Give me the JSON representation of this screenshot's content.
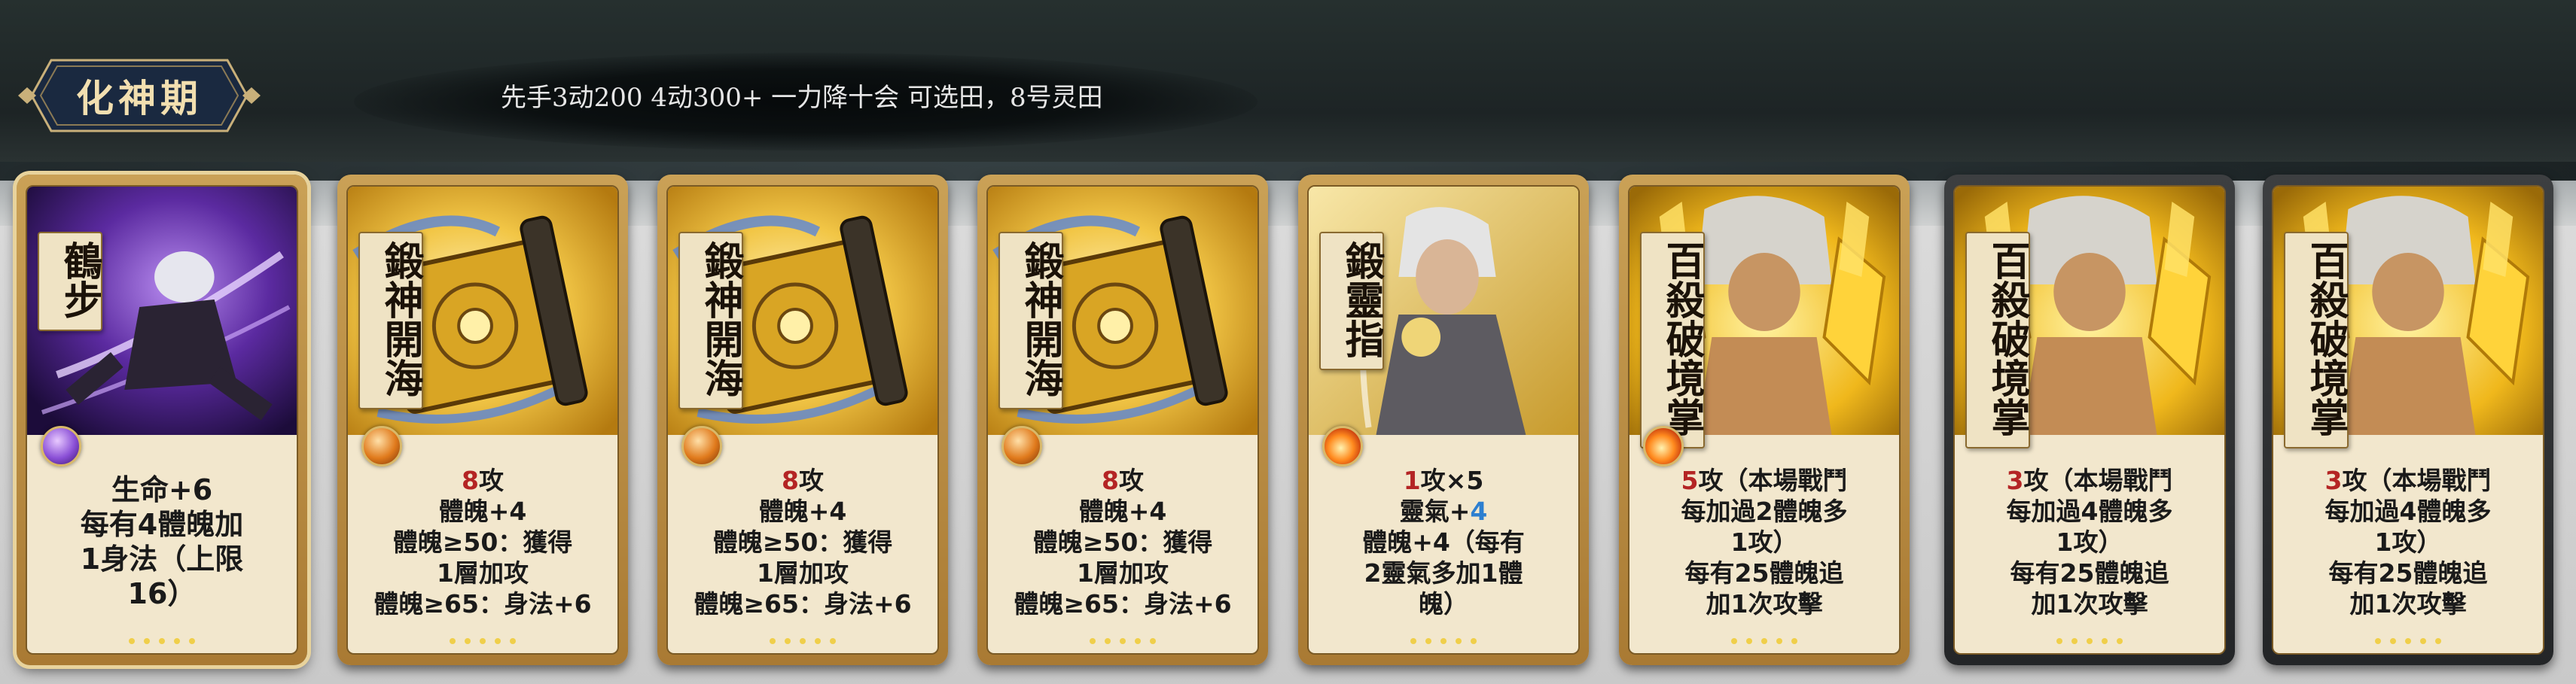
{
  "header": {
    "stage": "化神期",
    "note": "先手3动200  4动300+    一力降十会  可选田，8号灵田"
  },
  "colors": {
    "gold_frame": "#caa156",
    "dark_frame": "#2e3032",
    "attack_red": "#b42424",
    "qi_blue": "#2d7fd0",
    "orb_purple": "#8a4fd6",
    "orb_orange": "#e07a1c"
  },
  "cards": [
    {
      "name": "鶴步",
      "frame": "gold",
      "art": "purple-cultivator-art",
      "orb": "purple",
      "lines": [
        "生命+6",
        "每有4體魄加",
        "1身法（上限",
        "16）"
      ]
    },
    {
      "name": "鍛神開海",
      "frame": "gold",
      "art": "golden-scroll-art",
      "orb": "orange",
      "atk": "8",
      "atk_suffix": "攻",
      "lines": [
        "體魄+4",
        "體魄≥50：獲得",
        "1層加攻",
        "體魄≥65：身法+6"
      ]
    },
    {
      "name": "鍛神開海",
      "frame": "gold",
      "art": "golden-scroll-art",
      "orb": "orange",
      "atk": "8",
      "atk_suffix": "攻",
      "lines": [
        "體魄+4",
        "體魄≥50：獲得",
        "1層加攻",
        "體魄≥65：身法+6"
      ]
    },
    {
      "name": "鍛神開海",
      "frame": "gold",
      "art": "golden-scroll-art",
      "orb": "orange",
      "atk": "8",
      "atk_suffix": "攻",
      "lines": [
        "體魄+4",
        "體魄≥50：獲得",
        "1層加攻",
        "體魄≥65：身法+6"
      ]
    },
    {
      "name": "鍛靈指",
      "frame": "gold",
      "art": "white-haired-cultivator-art",
      "orb": "fire",
      "atk": "1",
      "atk_suffix": "攻×5",
      "qi_prefix": "靈氣+",
      "qi": "4",
      "lines": [
        "體魄+4（每有",
        "2靈氣多加1體",
        "魄）"
      ]
    },
    {
      "name": "百殺破境掌",
      "frame": "gold",
      "art": "golden-palm-art",
      "orb": "fire",
      "atk": "5",
      "atk_suffix": "攻（本場戰鬥",
      "lines": [
        "每加過2體魄多",
        "1攻）",
        "每有25體魄追",
        "加1次攻擊"
      ]
    },
    {
      "name": "百殺破境掌",
      "frame": "dark",
      "art": "golden-palm-art",
      "orb": "none",
      "atk": "3",
      "atk_suffix": "攻（本場戰鬥",
      "lines": [
        "每加過4體魄多",
        "1攻）",
        "每有25體魄追",
        "加1次攻擊"
      ]
    },
    {
      "name": "百殺破境掌",
      "frame": "dark",
      "art": "golden-palm-art",
      "orb": "none",
      "atk": "3",
      "atk_suffix": "攻（本場戰鬥",
      "lines": [
        "每加過4體魄多",
        "1攻）",
        "每有25體魄追",
        "加1次攻擊"
      ]
    }
  ]
}
